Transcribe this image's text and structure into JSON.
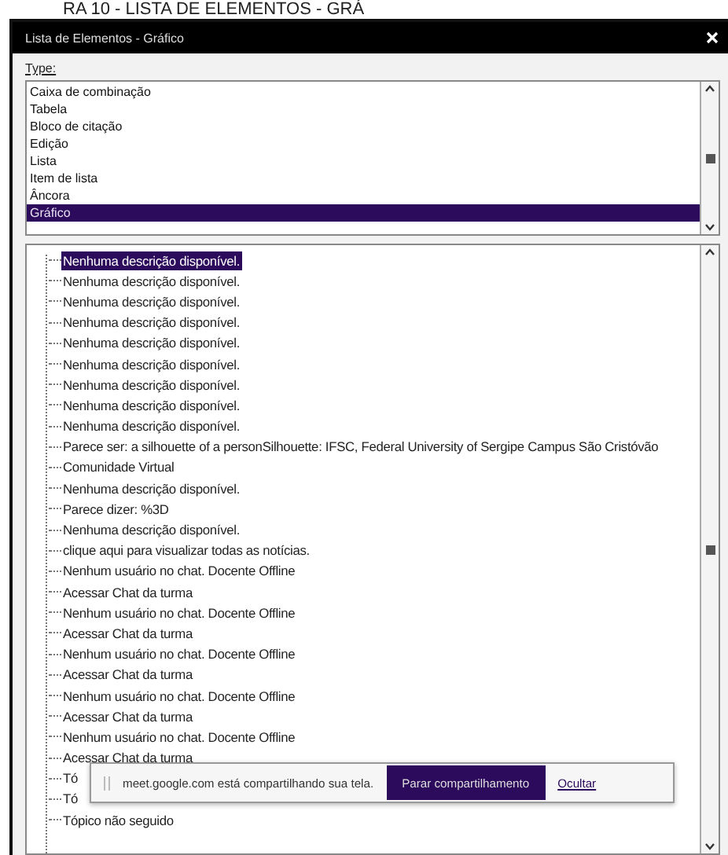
{
  "caption": "RA 10 - LISTA DE ELEMENTOS - GRÁ",
  "window": {
    "title": "Lista de Elementos - Gráfico"
  },
  "type_label": "Type:",
  "types": [
    {
      "label": "Caixa de combinação",
      "selected": false
    },
    {
      "label": "Tabela",
      "selected": false
    },
    {
      "label": "Bloco de citação",
      "selected": false
    },
    {
      "label": "Edição",
      "selected": false
    },
    {
      "label": "Lista",
      "selected": false
    },
    {
      "label": "Item de lista",
      "selected": false
    },
    {
      "label": "Âncora",
      "selected": false
    },
    {
      "label": "Gráfico",
      "selected": true
    }
  ],
  "elements": [
    {
      "label": "Nenhuma descrição disponível.",
      "selected": true
    },
    {
      "label": "Nenhuma descrição disponível.",
      "selected": false
    },
    {
      "label": "Nenhuma descrição disponível.",
      "selected": false
    },
    {
      "label": "Nenhuma descrição disponível.",
      "selected": false
    },
    {
      "label": "Nenhuma descrição disponível.",
      "selected": false
    },
    {
      "label": "Nenhuma descrição disponível.",
      "selected": false
    },
    {
      "label": "Nenhuma descrição disponível.",
      "selected": false
    },
    {
      "label": "Nenhuma descrição disponível.",
      "selected": false
    },
    {
      "label": "Nenhuma descrição disponível.",
      "selected": false
    },
    {
      "label": "Parece ser: a silhouette of a personSilhouette: IFSC, Federal University of Sergipe Campus São Cristóvão",
      "selected": false
    },
    {
      "label": "Comunidade Virtual",
      "selected": false
    },
    {
      "label": "Nenhuma descrição disponível.",
      "selected": false
    },
    {
      "label": "Parece dizer: %3D",
      "selected": false
    },
    {
      "label": "Nenhuma descrição disponível.",
      "selected": false
    },
    {
      "label": "clique aqui para visualizar todas as notícias.",
      "selected": false
    },
    {
      "label": "Nenhum usuário no chat. Docente Offline",
      "selected": false
    },
    {
      "label": "Acessar Chat da turma",
      "selected": false
    },
    {
      "label": "Nenhum usuário no chat. Docente Offline",
      "selected": false
    },
    {
      "label": "Acessar Chat da turma",
      "selected": false
    },
    {
      "label": "Nenhum usuário no chat. Docente Offline",
      "selected": false
    },
    {
      "label": "Acessar Chat da turma",
      "selected": false
    },
    {
      "label": "Nenhum usuário no chat. Docente Offline",
      "selected": false
    },
    {
      "label": "Acessar Chat da turma",
      "selected": false
    },
    {
      "label": "Nenhum usuário no chat. Docente Offline",
      "selected": false
    },
    {
      "label": "Acessar Chat da turma",
      "selected": false
    },
    {
      "label": "Tó",
      "selected": false
    },
    {
      "label": "Tó",
      "selected": false
    },
    {
      "label": "Tópico não seguido",
      "selected": false
    }
  ],
  "share_banner": {
    "message": "meet.google.com está compartilhando sua tela.",
    "stop_button": "Parar compartilhamento",
    "hide_link": "Ocultar"
  }
}
